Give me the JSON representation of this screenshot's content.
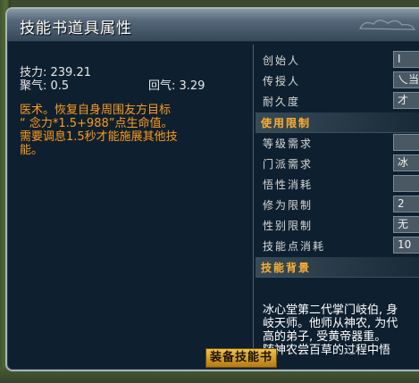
{
  "window": {
    "title": "技能书道具属性"
  },
  "stats": {
    "skill_power_label": "技力: 239.21",
    "gather_label": "聚气: 0.5",
    "return_label": "回气: 3.29"
  },
  "description": [
    "医术。恢复自身周围友方目标",
    "“ 念力*1.5+988”点生命值。",
    "需要调息1.5秒才能施展其他技",
    "能。"
  ],
  "properties": [
    {
      "label": "创始人",
      "value": "I"
    },
    {
      "label": "传授人",
      "value": "乀当"
    },
    {
      "label": "耐久度",
      "value": "才"
    }
  ],
  "section_usage": "使用限制",
  "limits": [
    {
      "label": "等级需求",
      "value": ""
    },
    {
      "label": "门派需求",
      "value": "冰"
    },
    {
      "label": "悟性消耗",
      "value": ""
    },
    {
      "label": "修为限制",
      "value": "2"
    },
    {
      "label": "性别限制",
      "value": "无"
    },
    {
      "label": "技能点消耗",
      "value": "10"
    }
  ],
  "section_background": "技能背景",
  "background_text": [
    "冰心堂第二代掌门岐伯, 身",
    "岐天师。他师从神农, 为代",
    "高的弟子, 受黄帝器重。",
    "随神农尝百草的过程中悟"
  ],
  "buttons": {
    "equip": "装备技能书"
  },
  "colors": {
    "accent_orange": "#ff9a1a",
    "section_orange": "#ffb030",
    "panel_bg": "#0e2030"
  }
}
